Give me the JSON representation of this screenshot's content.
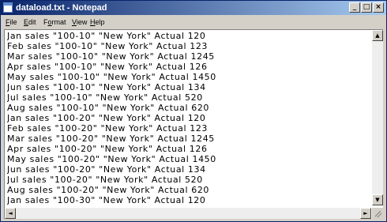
{
  "window": {
    "title": "dataload.txt - Notepad",
    "controls": {
      "minimize": "_",
      "maximize": "□",
      "close": "×"
    }
  },
  "menu": {
    "items": [
      {
        "first": "F",
        "rest": "ile"
      },
      {
        "first": "E",
        "rest": "dit"
      },
      {
        "first": "F",
        "rest": "ormat",
        "prefix": "F",
        "acc": "o",
        "suffix": "rmat"
      },
      {
        "first": "V",
        "rest": "iew"
      },
      {
        "first": "H",
        "rest": "elp"
      }
    ]
  },
  "editor": {
    "lines": [
      "Jan sales \"100-10\" \"New York\" Actual 120",
      "Feb sales \"100-10\" \"New York\" Actual 123",
      "Mar sales \"100-10\" \"New York\" Actual 1245",
      "Apr sales \"100-10\" \"New York\" Actual 126",
      "May sales \"100-10\" \"New York\" Actual 1450",
      "Jun sales \"100-10\" \"New York\" Actual 134",
      "Jul sales \"100-10\" \"New York\" Actual 520",
      "Aug sales \"100-10\" \"New York\" Actual 620",
      "Jan sales \"100-20\" \"New York\" Actual 120",
      "Feb sales \"100-20\" \"New York\" Actual 123",
      "Mar sales \"100-20\" \"New York\" Actual 1245",
      "Apr sales \"100-20\" \"New York\" Actual 126",
      "May sales \"100-20\" \"New York\" Actual 1450",
      "Jun sales \"100-20\" \"New York\" Actual 134",
      "Jul sales \"100-20\" \"New York\" Actual 520",
      "Aug sales \"100-20\" \"New York\" Actual 620",
      "Jan sales \"100-30\" \"New York\" Actual 120",
      "Feb sales \"100-30\" \"New York\" Actual 123",
      "Mar sales \"100-30\" \"New York\" Actual 1245"
    ]
  },
  "scrollbar": {
    "up": "▲",
    "down": "▼",
    "left": "◄",
    "right": "►"
  }
}
